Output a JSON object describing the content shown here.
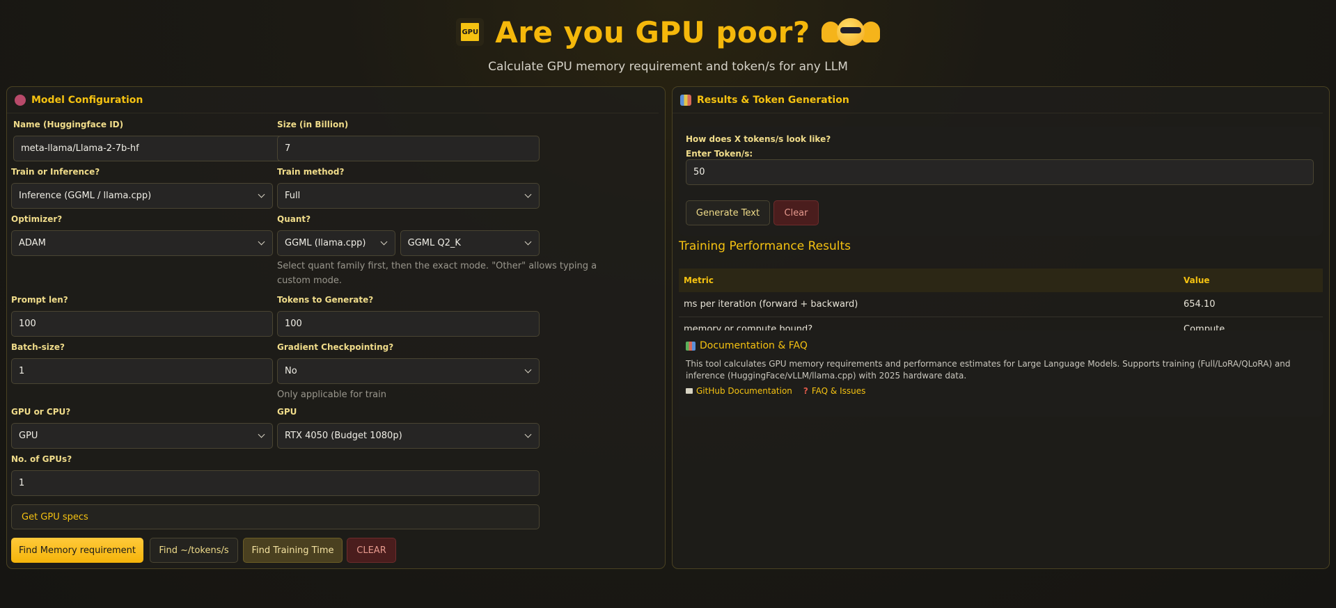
{
  "header": {
    "title": "Are you GPU poor?",
    "chip_text": "GPU",
    "subtitle": "Calculate GPU memory requirement and token/s for any LLM"
  },
  "left_panel": {
    "title": "Model Configuration",
    "fields": {
      "name": {
        "label": "Name (Huggingface ID)",
        "value": "meta-llama/Llama-2-7b-hf"
      },
      "size": {
        "label": "Size (in Billion)",
        "value": "7"
      },
      "train_or_inference": {
        "label": "Train or Inference?",
        "value": "Inference (GGML / llama.cpp)"
      },
      "train_method": {
        "label": "Train method?",
        "value": "Full"
      },
      "optimizer": {
        "label": "Optimizer?",
        "value": "ADAM"
      },
      "quant": {
        "label": "Quant?",
        "family": "GGML (llama.cpp)",
        "mode": "GGML Q2_K",
        "hint": "Select quant family first, then the exact mode. \"Other\" allows typing a custom mode."
      },
      "prompt_len": {
        "label": "Prompt len?",
        "value": "100"
      },
      "tokens_to_generate": {
        "label": "Tokens to Generate?",
        "value": "100"
      },
      "batch_size": {
        "label": "Batch-size?",
        "value": "1"
      },
      "gradient_checkpointing": {
        "label": "Gradient Checkpointing?",
        "value": "No",
        "hint": "Only applicable for train"
      },
      "gpu_or_cpu": {
        "label": "GPU or CPU?",
        "value": "GPU"
      },
      "gpu": {
        "label": "GPU",
        "value": "RTX 4050 (Budget 1080p)"
      },
      "num_gpus": {
        "label": "No. of GPUs?",
        "value": "1"
      }
    },
    "get_specs_label": "Get GPU specs",
    "buttons": {
      "memory": "Find Memory requirement",
      "tokens": "Find ~/tokens/s",
      "training_time": "Find Training Time",
      "clear": "CLEAR"
    }
  },
  "right_panel": {
    "title": "Results & Token Generation",
    "token_box": {
      "question": "How does X tokens/s look like?",
      "label": "Enter Token/s:",
      "value": "50",
      "generate_label": "Generate Text",
      "clear_label": "Clear"
    },
    "results_title": "Training Performance Results",
    "table": {
      "headers": [
        "Metric",
        "Value"
      ],
      "rows": [
        [
          "ms per iteration (forward + backward)",
          "654.10"
        ],
        [
          "memory or compute bound?",
          "Compute"
        ]
      ]
    },
    "docs": {
      "title": "Documentation & FAQ",
      "text": "This tool calculates GPU memory requirements and performance estimates for Large Language Models. Supports training (Full/LoRA/QLoRA) and inference (HuggingFace/vLLM/llama.cpp) with 2025 hardware data.",
      "github_label": "GitHub Documentation",
      "faq_label": "FAQ & Issues"
    }
  },
  "colors": {
    "accent": "#f5c211",
    "title": "#f5b80b",
    "danger": "#4a1d1d"
  }
}
